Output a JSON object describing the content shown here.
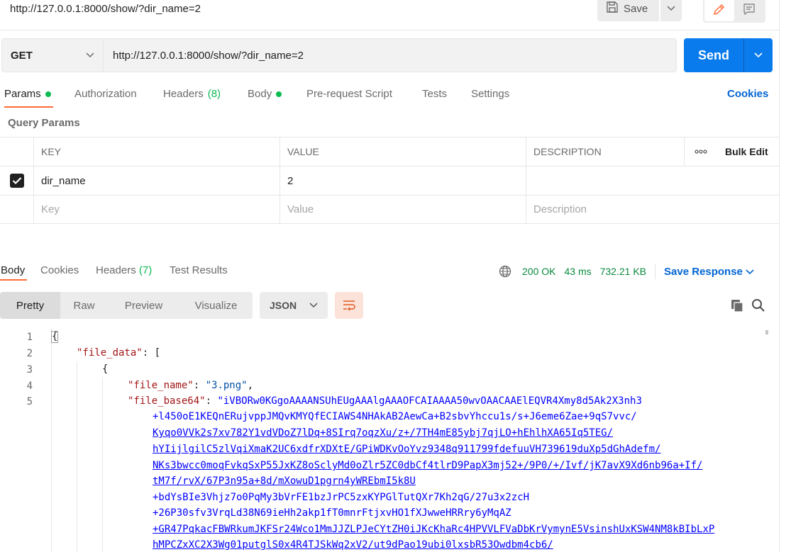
{
  "top": {
    "request_url": "http://127.0.0.1:8000/show/?dir_name=2",
    "save_label": "Save"
  },
  "request": {
    "method": "GET",
    "url": "http://127.0.0.1:8000/show/?dir_name=2",
    "send_label": "Send"
  },
  "request_tabs": [
    {
      "label": "Params",
      "dot": true
    },
    {
      "label": "Authorization"
    },
    {
      "label": "Headers",
      "count": "(8)"
    },
    {
      "label": "Body",
      "dot": true
    },
    {
      "label": "Pre-request Script"
    },
    {
      "label": "Tests"
    },
    {
      "label": "Settings"
    }
  ],
  "cookies_label": "Cookies",
  "query_params": {
    "title": "Query Params",
    "headers": {
      "key": "KEY",
      "value": "VALUE",
      "description": "DESCRIPTION",
      "more": "ooo",
      "bulk_edit": "Bulk Edit"
    },
    "rows": [
      {
        "key": "dir_name",
        "value": "2",
        "description": "",
        "checked": true
      }
    ],
    "placeholders": {
      "key": "Key",
      "value": "Value",
      "description": "Description"
    }
  },
  "response": {
    "tabs": [
      {
        "label": "Body"
      },
      {
        "label": "Cookies"
      },
      {
        "label": "Headers",
        "count": "(7)"
      },
      {
        "label": "Test Results"
      }
    ],
    "status": "200 OK",
    "time": "43 ms",
    "size": "732.21 KB",
    "save_response": "Save Response",
    "view_tabs": [
      "Pretty",
      "Raw",
      "Preview",
      "Visualize"
    ],
    "format": "JSON"
  },
  "code": {
    "line_numbers": [
      "1",
      "2",
      "3",
      "4",
      "5"
    ],
    "open_brace": "{",
    "file_data_key": "\"file_data\"",
    "open_bracket": ": [",
    "inner_brace": "{",
    "file_name_key": "\"file_name\"",
    "file_name_value": "\"3.png\"",
    "file_base64_key": "\"file_base64\"",
    "b64_lines": [
      "\"iVBORw0KGgoAAAANSUhEUgAAAlgAAAOFCAIAAAA50wvOAACAAElEQVR4Xmy8d5Ak2X3nh3",
      "+l450oE1KEQnERujvppJMQvKMYQfECIAWS4NHAkAB2AewCa+B2sbvYhccu1s/s+J6eme6Zae+9qS7vvc/",
      "Kyqo0VVk2s7xv782Y1vdVDoZ7lDq+8SIrq7oqzXu/z+/7TH4mE85ybj7qjLO+hEhlhXA65Iq5TEG/",
      "hYIijlgilC5zlVqiXmaK2UC6xdfrXDXtE/GPiWDKvOoYvz9348q911799fdefuuVH739619duXp5dGhAdefm/",
      "NKs3bwcc0moqFvkqSxP55JxKZ8oSclyMd0oZlr5ZC0dbCf4tlrD9PapX3mj52+/9P0/+/Ivf/jK7avX9Xd6nb96a+If/",
      "tM7f/rvX/67P3n95a+8d/mXowuD1pgrn4yWREbmI5k8U",
      "+bdYsBIe3Vhjz7o0PqMy3bVrFE1bzJrPC5zxKYPGlTutQXr7Kh2qG/27u3x2zcH",
      "+26P30sfv3VrqLd38N69ieHh2akp1fT0mnrFtjxvHO1fXJwweHRRry6yMqAZ",
      "+GR47PqkacFBWRkumJKFSr24Wco1MmJJZLPJeCYtZH0iJKcKhaRc4HPVVLFVaDbKrVymynE5VsinshUxKSW4NM8kBIbLxP",
      "hMPCZxXC2X3Wg01putglS0x4R4TJSkWq2xV2/ut9dPao19ubi0lxsbR53Owdbm4cb6/"
    ]
  }
}
